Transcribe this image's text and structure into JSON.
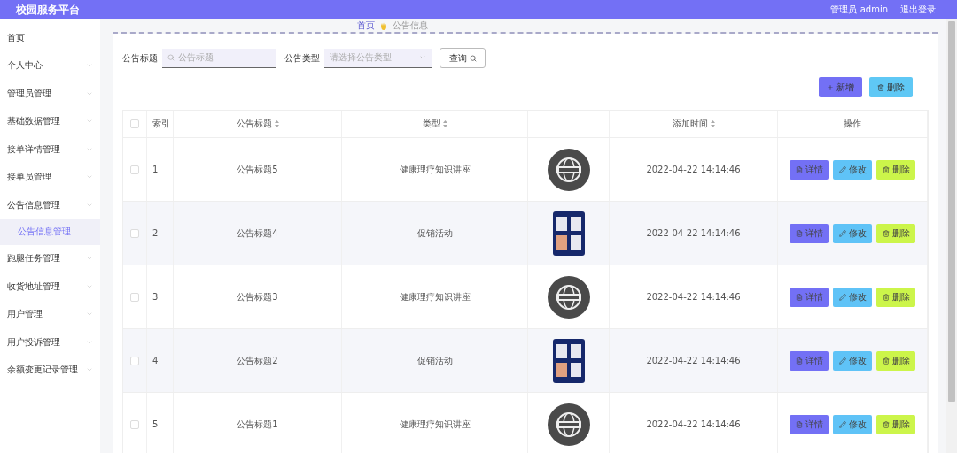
{
  "header": {
    "title": "校园服务平台",
    "user": "管理员 admin",
    "logout": "退出登录"
  },
  "sidebar": {
    "items": [
      {
        "label": "首页",
        "has_submenu": false
      },
      {
        "label": "个人中心",
        "has_submenu": true
      },
      {
        "label": "管理员管理",
        "has_submenu": true
      },
      {
        "label": "基础数据管理",
        "has_submenu": true
      },
      {
        "label": "接单详情管理",
        "has_submenu": true
      },
      {
        "label": "接单员管理",
        "has_submenu": true
      },
      {
        "label": "公告信息管理",
        "has_submenu": true,
        "children": [
          {
            "label": "公告信息管理",
            "selected": true
          }
        ]
      },
      {
        "label": "跑腿任务管理",
        "has_submenu": true
      },
      {
        "label": "收货地址管理",
        "has_submenu": true
      },
      {
        "label": "用户管理",
        "has_submenu": true
      },
      {
        "label": "用户投诉管理",
        "has_submenu": true
      },
      {
        "label": "余额变更记录管理",
        "has_submenu": true
      }
    ]
  },
  "breadcrumb": [
    "首页",
    "公告信息"
  ],
  "search": {
    "fields": [
      {
        "kind": "text",
        "label": "公告标题",
        "placeholder": "公告标题"
      },
      {
        "kind": "select",
        "label": "公告类型",
        "placeholder": "请选择公告类型"
      }
    ],
    "button": "查询"
  },
  "actions": [
    {
      "kind": "add",
      "label": "新增"
    },
    {
      "kind": "delete",
      "label": "删除"
    }
  ],
  "table": {
    "header_checked": false,
    "columns": [
      {
        "kind": "checkbox"
      },
      {
        "kind": "text",
        "label": "索引",
        "sortable": false
      },
      {
        "kind": "text",
        "label": "公告标题",
        "sortable": true
      },
      {
        "kind": "text",
        "label": "类型",
        "sortable": true
      },
      {
        "kind": "picture"
      },
      {
        "kind": "text",
        "label": "添加时间",
        "sortable": true
      },
      {
        "kind": "text",
        "label": "操作",
        "sortable": false
      }
    ],
    "rows": [
      {
        "checked": false,
        "index": "1",
        "title": "公告标题5",
        "type": "健康理疗知识讲座",
        "picture": {
          "kind": "picture"
        },
        "time": "2022-04-22 14:14:46",
        "actions": [
          {
            "kind": "detail",
            "label": "详情"
          },
          {
            "kind": "edit",
            "label": "修改"
          },
          {
            "kind": "delete",
            "label": "删除"
          }
        ]
      },
      {
        "checked": false,
        "index": "2",
        "title": "公告标题4",
        "type": "促销活动",
        "picture": {
          "kind": "picture"
        },
        "time": "2022-04-22 14:14:46",
        "actions": [
          {
            "kind": "detail",
            "label": "详情"
          },
          {
            "kind": "edit",
            "label": "修改"
          },
          {
            "kind": "delete",
            "label": "删除"
          }
        ]
      },
      {
        "checked": false,
        "index": "3",
        "title": "公告标题3",
        "type": "健康理疗知识讲座",
        "picture": {
          "kind": "picture"
        },
        "time": "2022-04-22 14:14:46",
        "actions": [
          {
            "kind": "detail",
            "label": "详情"
          },
          {
            "kind": "edit",
            "label": "修改"
          },
          {
            "kind": "delete",
            "label": "删除"
          }
        ]
      },
      {
        "checked": false,
        "index": "4",
        "title": "公告标题2",
        "type": "促销活动",
        "picture": {
          "kind": "picture"
        },
        "time": "2022-04-22 14:14:46",
        "actions": [
          {
            "kind": "detail",
            "label": "详情"
          },
          {
            "kind": "edit",
            "label": "修改"
          },
          {
            "kind": "delete",
            "label": "删除"
          }
        ]
      },
      {
        "checked": false,
        "index": "5",
        "title": "公告标题1",
        "type": "健康理疗知识讲座",
        "picture": {
          "kind": "picture"
        },
        "time": "2022-04-22 14:14:46",
        "actions": [
          {
            "kind": "detail",
            "label": "详情"
          },
          {
            "kind": "edit",
            "label": "修改"
          },
          {
            "kind": "delete",
            "label": "删除"
          }
        ]
      }
    ]
  }
}
